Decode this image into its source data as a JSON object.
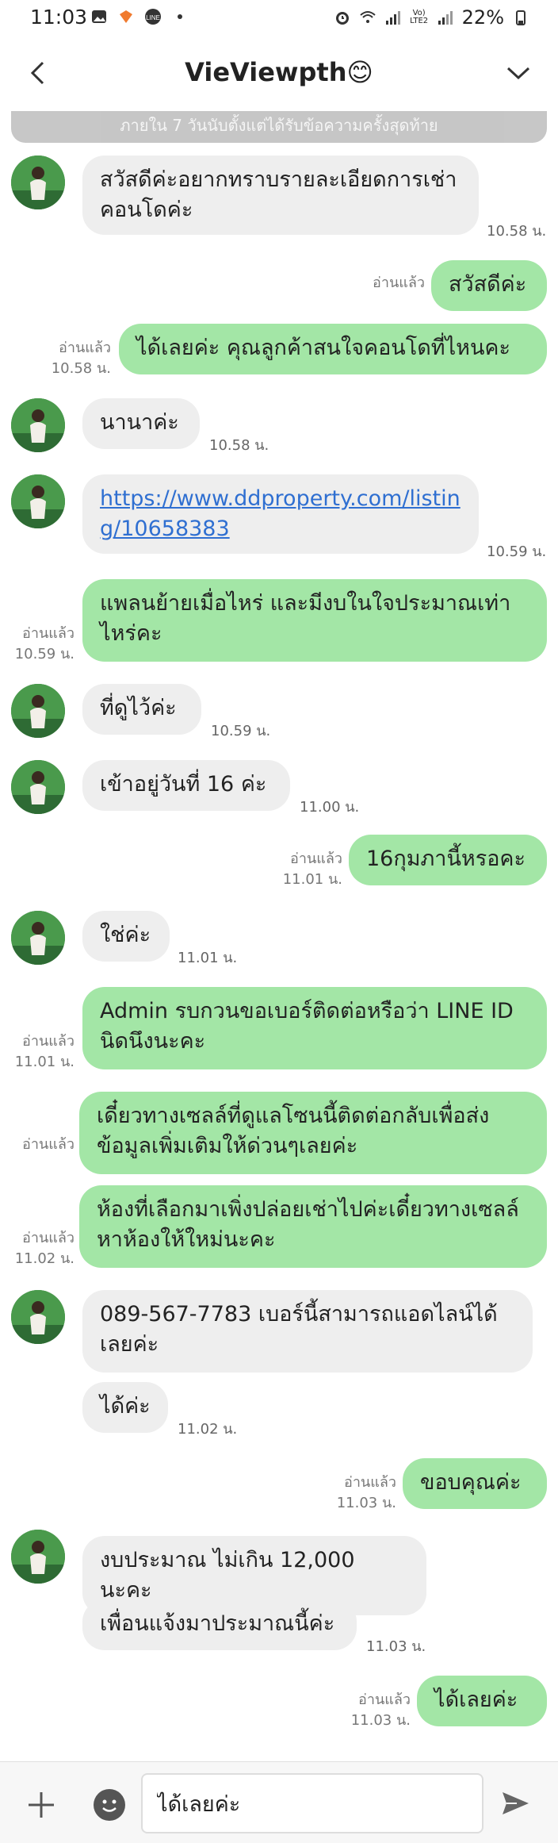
{
  "status_bar": {
    "time": "11:03",
    "battery": "22%",
    "network": "Vo) LTE2"
  },
  "header": {
    "title": "VieViewpth😊"
  },
  "notice": "ภายใน 7 วันนับตั้งแต่ได้รับข้อความครั้งสุดท้าย",
  "messages": [
    {
      "side": "in",
      "text": "สวัสดีค่ะอยากทราบรายละเอียดการเช่าคอนโดค่ะ",
      "time": "10.58 น."
    },
    {
      "side": "out",
      "text": "สวัสดีค่ะ",
      "read": "อ่านแล้ว",
      "time": ""
    },
    {
      "side": "out",
      "text": "ได้เลยค่ะ คุณลูกค้าสนใจคอนโดที่ไหนคะ",
      "read": "อ่านแล้ว",
      "time": "10.58 น."
    },
    {
      "side": "in",
      "text": "นานาค่ะ",
      "time": "10.58 น."
    },
    {
      "side": "in",
      "link": true,
      "text": "https://www.ddproperty.com/listing/10658383",
      "time": "10.59 น."
    },
    {
      "side": "out",
      "text": "แพลนย้ายเมื่อไหร่ และมีงบในใจประมาณเท่าไหร่คะ",
      "read": "อ่านแล้ว",
      "time": "10.59 น."
    },
    {
      "side": "in",
      "text": "ที่ดูไว้ค่ะ",
      "time": "10.59 น."
    },
    {
      "side": "in",
      "text": "เข้าอยู่วันที่ 16 ค่ะ",
      "time": "11.00 น."
    },
    {
      "side": "out",
      "text": "16กุมภานี้หรอคะ",
      "read": "อ่านแล้ว",
      "time": "11.01 น."
    },
    {
      "side": "in",
      "text": "ใช่ค่ะ",
      "time": "11.01 น."
    },
    {
      "side": "out",
      "text": "Admin รบกวนขอเบอร์ติดต่อหรือว่า LINE ID นิดนึงนะคะ",
      "read": "อ่านแล้ว",
      "time": "11.01 น."
    },
    {
      "side": "out",
      "text": "เดี๋ยวทางเซลล์ที่ดูแลโซนนี้ติดต่อกลับเพื่อส่งข้อมูลเพิ่มเติมให้ด่วนๆเลยค่ะ",
      "read": "อ่านแล้ว",
      "time": ""
    },
    {
      "side": "out",
      "text": "ห้องที่เลือกมาเพิ่งปล่อยเช่าไปค่ะเดี๋ยวทางเซลล์หาห้องให้ใหม่นะคะ",
      "read": "อ่านแล้ว",
      "time": "11.02 น."
    },
    {
      "side": "in",
      "text": "089-567-7783 เบอร์นี้สามารถแอดไลน์ได้เลยค่ะ",
      "time": ""
    },
    {
      "side": "in",
      "text": "ได้ค่ะ",
      "time": "11.02 น."
    },
    {
      "side": "out",
      "text": "ขอบคุณค่ะ",
      "read": "อ่านแล้ว",
      "time": "11.03 น."
    },
    {
      "side": "in",
      "text": "งบประมาณ ไม่เกิน 12,000 นะคะ",
      "time": ""
    },
    {
      "side": "in",
      "text": "เพื่อนแจ้งมาประมาณนี้ค่ะ",
      "time": "11.03 น."
    },
    {
      "side": "out",
      "text": "ได้เลยค่ะ",
      "read": "อ่านแล้ว",
      "time": "11.03 น."
    }
  ],
  "input": {
    "value": "ได้เลยค่ะ"
  },
  "colors": {
    "outgoing": "#a3e6a6",
    "incoming": "#eeeeee",
    "link": "#2f6fd1"
  }
}
